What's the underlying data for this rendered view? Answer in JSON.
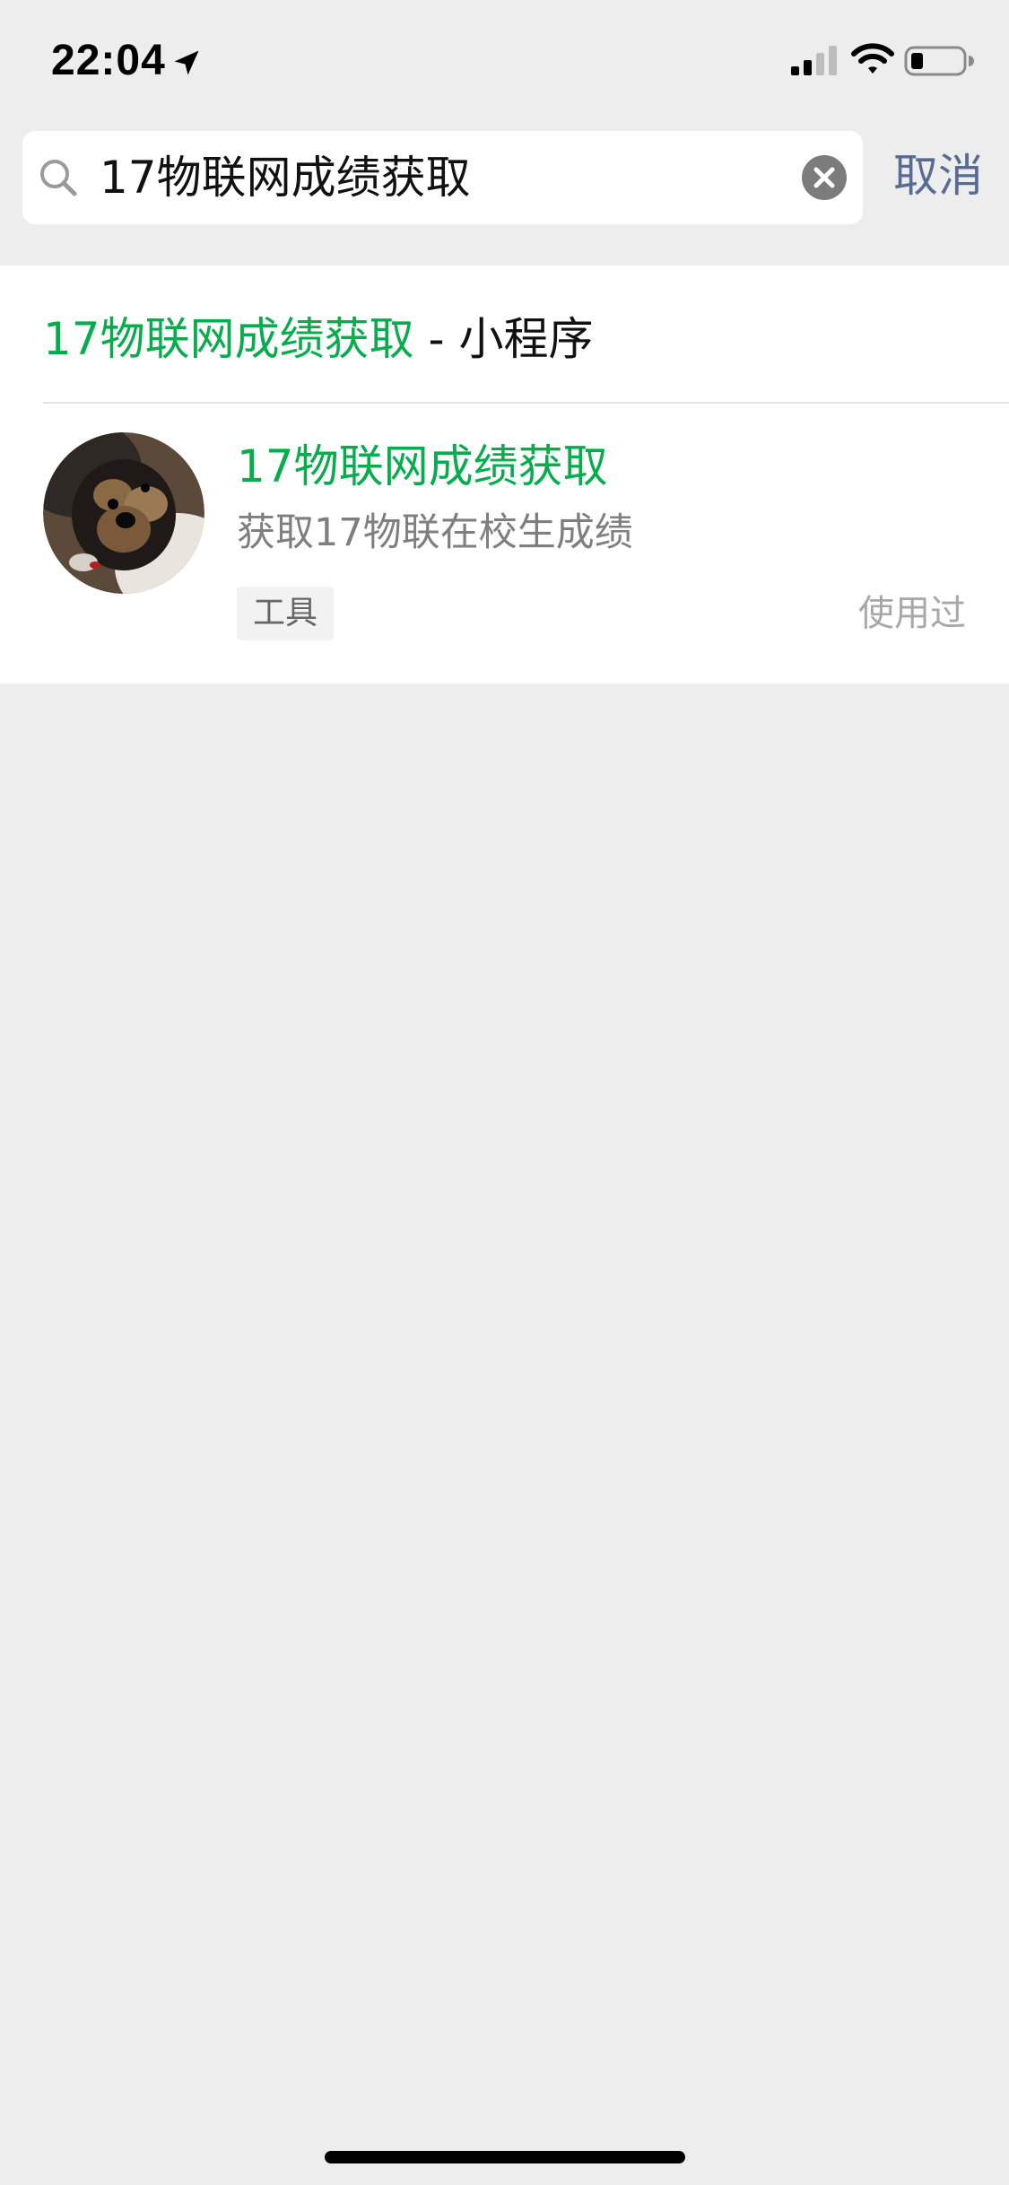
{
  "status_bar": {
    "time": "22:04"
  },
  "search": {
    "query": "17物联网成绩获取",
    "cancel_label": "取消"
  },
  "section": {
    "title_highlight": "17物联网成绩获取",
    "title_suffix": " - 小程序"
  },
  "result": {
    "title": "17物联网成绩获取",
    "description": "获取17物联在校生成绩",
    "tag": "工具",
    "status": "使用过"
  },
  "colors": {
    "highlight_green": "#07ad4c",
    "link_blue": "#576b95",
    "background": "#ededed"
  },
  "icons": [
    "location-arrow-icon",
    "cellular-signal-icon",
    "wifi-icon",
    "battery-icon",
    "search-icon",
    "clear-icon"
  ]
}
